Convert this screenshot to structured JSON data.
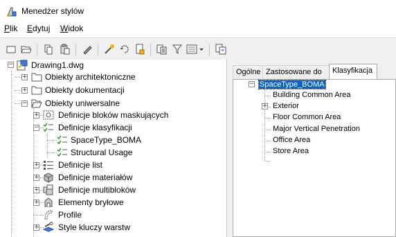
{
  "window": {
    "title": "Menedżer stylów"
  },
  "menu": [
    {
      "label": "Plik",
      "accel": "P",
      "rest": "lik"
    },
    {
      "label": "Edytuj",
      "accel": "E",
      "rest": "dytuj"
    },
    {
      "label": "Widok",
      "accel": "W",
      "rest": "idok"
    }
  ],
  "tree": {
    "root": "Drawing1.dwg",
    "items": [
      {
        "label": "Obiekty architektoniczne",
        "icon": "folder-icon"
      },
      {
        "label": "Obiekty dokumentacji",
        "icon": "folder-icon"
      },
      {
        "label": "Obiekty uniwersalne",
        "icon": "folder-open-icon"
      },
      {
        "label": "Definicje bloków maskujących",
        "icon": "mask-block-icon"
      },
      {
        "label": "Definicje klasyfikacji",
        "icon": "classification-icon"
      },
      {
        "label": "SpaceType_BOMA",
        "icon": "classification-icon"
      },
      {
        "label": "Structural Usage",
        "icon": "classification-icon"
      },
      {
        "label": "Definicje list",
        "icon": "list-icon"
      },
      {
        "label": "Definicje materiałów",
        "icon": "material-icon"
      },
      {
        "label": "Definicje multibloków",
        "icon": "multiblock-icon"
      },
      {
        "label": "Elementy bryłowe",
        "icon": "mass-element-icon"
      },
      {
        "label": "Profile",
        "icon": "profile-icon"
      },
      {
        "label": "Style kluczy warstw",
        "icon": "layer-key-icon"
      }
    ]
  },
  "tabs": [
    "Ogólne",
    "Zastosowane do",
    "Klasyfikacja"
  ],
  "active_tab": "Klasyfikacja",
  "classification": {
    "root": "SpaceType_BOMA",
    "children": [
      "Building Common Area",
      "Exterior",
      "Floor Common Area",
      "Major Vertical Penetration",
      "Office Area",
      "Store Area"
    ]
  },
  "colors": {
    "selection": "#0a64c8",
    "tree_lines": "#a0a0a0",
    "toolbar_bg": "#f0f0f0"
  }
}
